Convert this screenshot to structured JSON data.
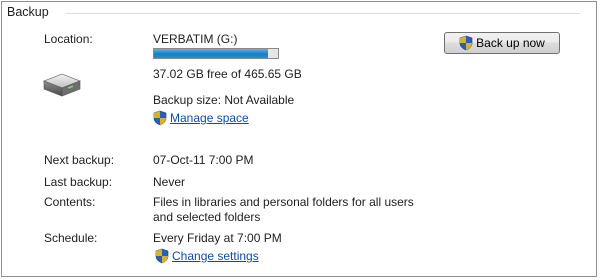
{
  "group": {
    "title": "Backup"
  },
  "location": {
    "label": "Location:",
    "drive": "VERBATIM (G:)",
    "used_fraction": 0.92,
    "free_text": "37.02 GB free of 465.65 GB",
    "backup_size": "Backup size: Not Available",
    "manage_link": "Manage space"
  },
  "backup_button": {
    "label": "Back up now"
  },
  "details": [
    {
      "label": "Next backup:",
      "value": "07-Oct-11 7:00 PM"
    },
    {
      "label": "Last backup:",
      "value": "Never"
    },
    {
      "label": "Contents:",
      "value": "Files in libraries and personal folders for all users",
      "value2": "and selected folders"
    },
    {
      "label": "Schedule:",
      "value": "Every Friday at 7:00 PM"
    }
  ],
  "change_link": "Change settings",
  "icons": {
    "drive": "hard-drive-icon",
    "shield": "uac-shield-icon"
  },
  "colors": {
    "link": "#0a4fa6",
    "bar_fill": "#1a7cc0"
  }
}
